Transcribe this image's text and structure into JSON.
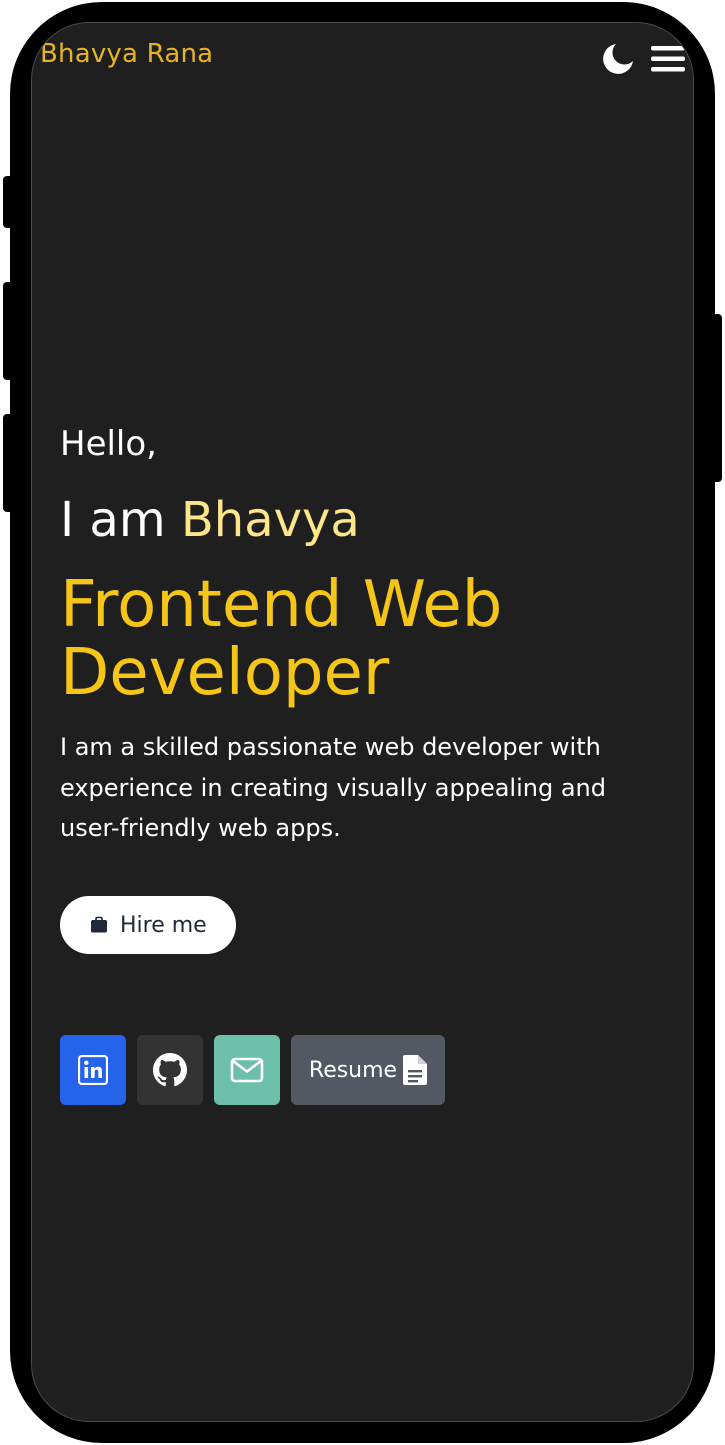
{
  "header": {
    "logo": "Bhavya Rana",
    "theme_toggle_icon": "moon-icon",
    "menu_icon": "hamburger-menu-icon"
  },
  "hero": {
    "greeting": "Hello,",
    "intro_prefix": "I am ",
    "intro_name": "Bhavya",
    "role": "Frontend Web Developer",
    "description": "I am a skilled passionate web developer with experience in creating visually appealing and user-friendly web apps."
  },
  "hire_button": {
    "label": "Hire me",
    "icon": "briefcase-icon"
  },
  "socials": [
    {
      "name": "linkedin",
      "icon": "linkedin-icon",
      "color": "#2563eb"
    },
    {
      "name": "github",
      "icon": "github-icon",
      "color": "#333333"
    },
    {
      "name": "email",
      "icon": "mail-icon",
      "color": "#6cbfab"
    },
    {
      "name": "resume",
      "label": "Resume",
      "icon": "document-icon",
      "color": "#535862"
    }
  ],
  "colors": {
    "background": "#1f1f1f",
    "accent": "#f5c518",
    "logo": "#e6b422",
    "name_highlight": "#fde68a",
    "text": "#ffffff"
  }
}
